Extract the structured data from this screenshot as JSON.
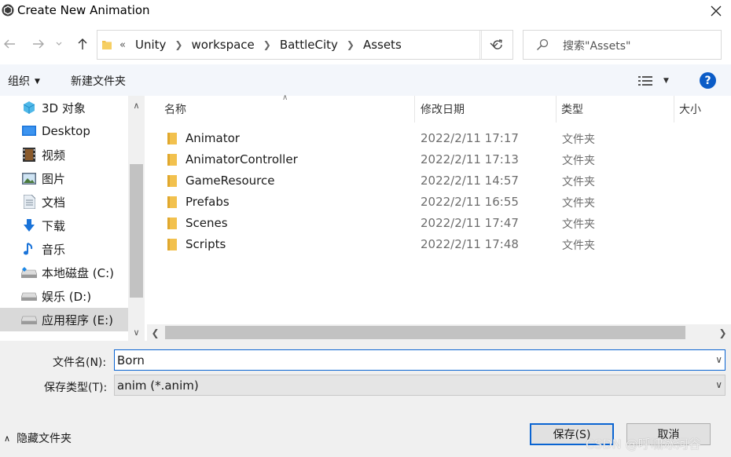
{
  "window": {
    "title": "Create New Animation",
    "close_icon": "close-icon"
  },
  "nav": {
    "crumb_overflow": "«",
    "breadcrumbs": [
      "Unity",
      "workspace",
      "BattleCity",
      "Assets"
    ],
    "search_placeholder": "搜索\"Assets\""
  },
  "commands": {
    "organize": "组织",
    "new_folder": "新建文件夹"
  },
  "sidebar": {
    "items": [
      {
        "label": "3D 对象",
        "icon": "cube-icon"
      },
      {
        "label": "Desktop",
        "icon": "desktop-icon"
      },
      {
        "label": "视频",
        "icon": "video-icon"
      },
      {
        "label": "图片",
        "icon": "picture-icon"
      },
      {
        "label": "文档",
        "icon": "document-icon"
      },
      {
        "label": "下载",
        "icon": "download-icon"
      },
      {
        "label": "音乐",
        "icon": "music-icon"
      },
      {
        "label": "本地磁盘 (C:)",
        "icon": "drive-icon"
      },
      {
        "label": "娱乐 (D:)",
        "icon": "drive-icon"
      },
      {
        "label": "应用程序 (E:)",
        "icon": "drive-icon",
        "selected": true
      }
    ]
  },
  "columns": {
    "name": "名称",
    "modified": "修改日期",
    "type": "类型",
    "size": "大小"
  },
  "files": [
    {
      "name": "Animator",
      "modified": "2022/2/11 17:17",
      "type": "文件夹"
    },
    {
      "name": "AnimatorController",
      "modified": "2022/2/11 17:13",
      "type": "文件夹"
    },
    {
      "name": "GameResource",
      "modified": "2022/2/11 14:57",
      "type": "文件夹"
    },
    {
      "name": "Prefabs",
      "modified": "2022/2/11 16:55",
      "type": "文件夹"
    },
    {
      "name": "Scenes",
      "modified": "2022/2/11 17:47",
      "type": "文件夹"
    },
    {
      "name": "Scripts",
      "modified": "2022/2/11 17:48",
      "type": "文件夹"
    }
  ],
  "form": {
    "filename_label": "文件名(N):",
    "filename_value": "Born",
    "filetype_label": "保存类型(T):",
    "filetype_value": "anim (*.anim)"
  },
  "footer": {
    "hide_folders": "隐藏文件夹",
    "save": "保存(S)",
    "cancel": "取消",
    "watermark": "CSDN @呼啸冰河谷"
  },
  "colors": {
    "accent": "#0a64d2",
    "folder": "#f2c14e",
    "selected_bg": "#d9d9d9"
  }
}
